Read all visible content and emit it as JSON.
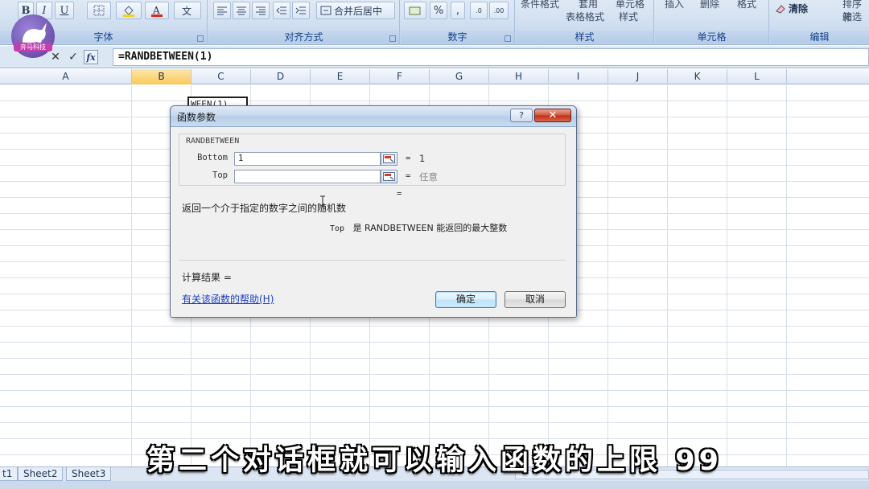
{
  "ribbon": {
    "groups": {
      "font": "字体",
      "alignment": "对齐方式",
      "number": "数字",
      "styles": "样式",
      "cells": "单元格",
      "editing": "编辑"
    },
    "buttons": {
      "bold": "B",
      "italic": "I",
      "underline": "U",
      "merge_center": "合并后居中",
      "percent": "%",
      "comma": ",",
      "conditional_format": "条件格式",
      "format_as_table": "套用",
      "table_format": "表格格式",
      "cell_styles_1": "单元格",
      "cell_styles_2": "样式",
      "insert": "插入",
      "delete": "删除",
      "format": "格式",
      "clear": "清除",
      "sort": "排序和",
      "filter": "筛选"
    },
    "logo_text": "奔马科技"
  },
  "formula_bar": {
    "cancel": "✕",
    "enter": "✓",
    "fx": "fx",
    "formula": "=RANDBETWEEN(1)"
  },
  "grid": {
    "columns": [
      "A",
      "B",
      "C",
      "D",
      "E",
      "F",
      "G",
      "H",
      "I",
      "J",
      "K",
      "L"
    ],
    "active_column": "B",
    "active_cell_text": "WEEN(1)"
  },
  "sheets": {
    "tabs": [
      "t1",
      "Sheet2",
      "Sheet3"
    ]
  },
  "dialog": {
    "title": "函数参数",
    "help_button": "?",
    "close_button": "✕",
    "function_name": "RANDBETWEEN",
    "args": [
      {
        "label": "Bottom",
        "value": "1",
        "eq": "=",
        "result": "1"
      },
      {
        "label": "Top",
        "value": "",
        "eq": "=",
        "result": "任意"
      }
    ],
    "result_eq": "=",
    "description": "返回一个介于指定的数字之间的随机数",
    "arg_description_name": "Top",
    "arg_description_text": "是 RANDBETWEEN 能返回的最大整数",
    "calc_result": "计算结果 =",
    "help_link": "有关该函数的帮助(H)",
    "ok": "确定",
    "cancel": "取消"
  },
  "subtitle": "第二个对话框就可以输入函数的上限 99",
  "colors": {
    "ribbon_bg": "#d0dff0",
    "active_column": "#f8c85c",
    "close_button": "#c0321b",
    "link": "#1a3ec4"
  }
}
